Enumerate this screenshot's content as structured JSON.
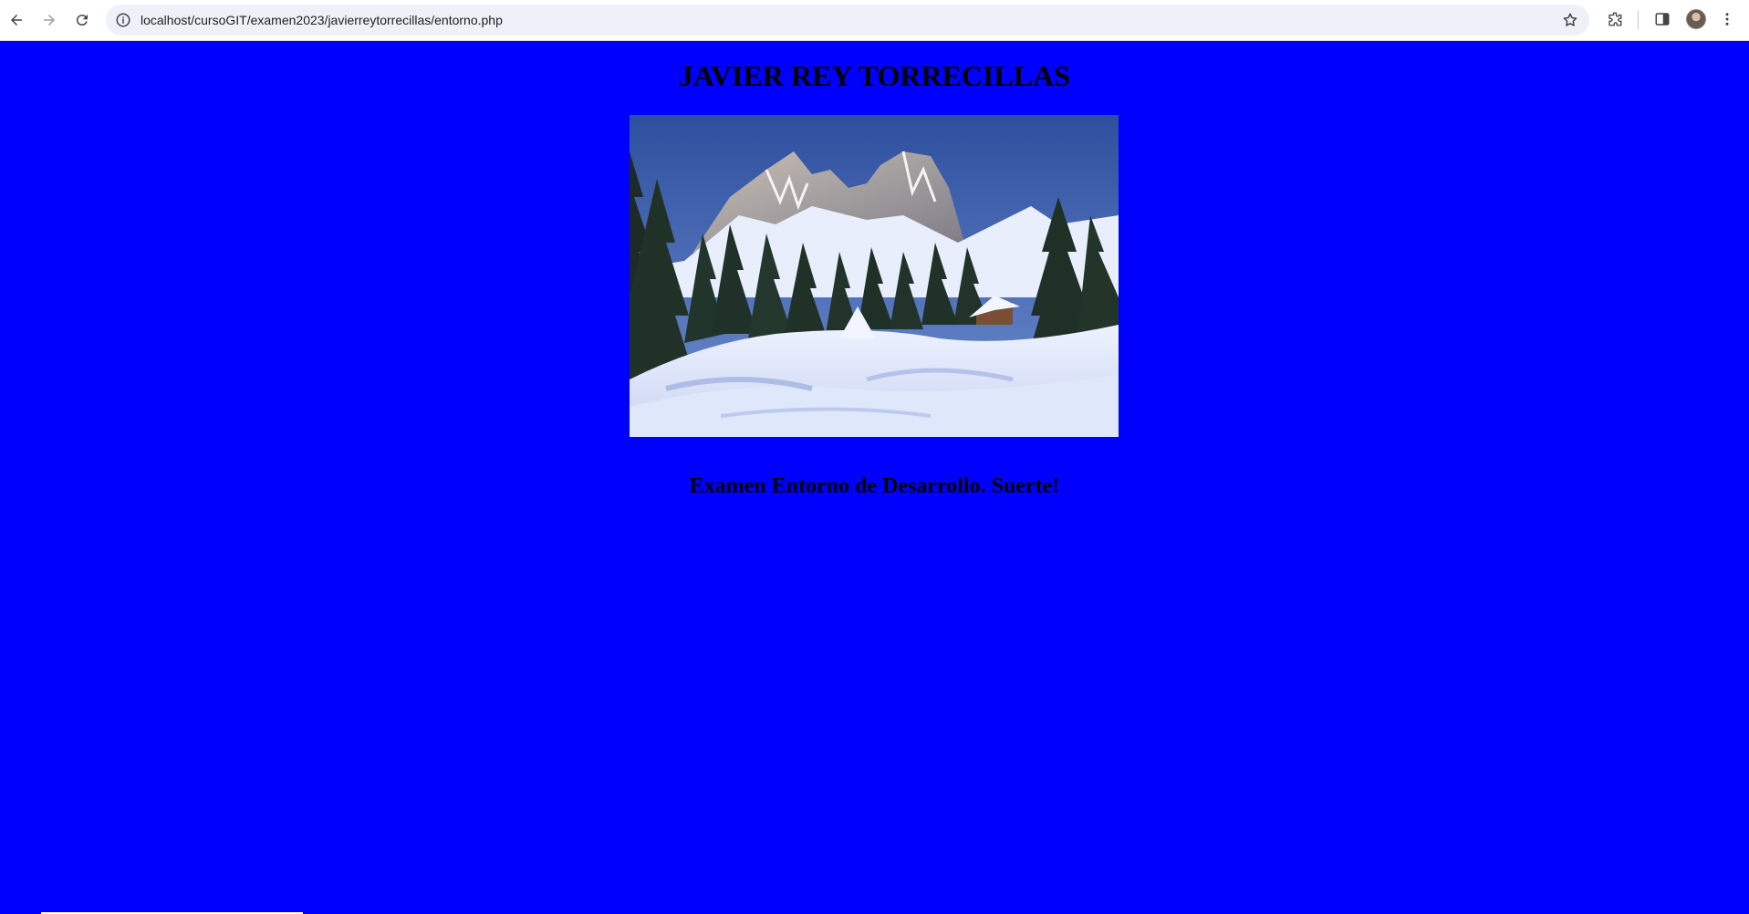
{
  "browser": {
    "url": "localhost/cursoGIT/examen2023/javierreytorrecillas/entorno.php",
    "icons": [
      "back-arrow-icon",
      "forward-arrow-icon",
      "reload-icon",
      "site-info-icon",
      "bookmark-star-icon",
      "extensions-icon",
      "side-panel-icon",
      "profile-avatar",
      "kebab-menu-icon"
    ]
  },
  "page": {
    "background_color": "#0000ff",
    "heading": "JAVIER REY TORRECILLAS",
    "image": {
      "subject": "snowy-mountain-landscape-photo"
    },
    "message": "Examen Entorno de Desarrollo. Suerte!"
  }
}
